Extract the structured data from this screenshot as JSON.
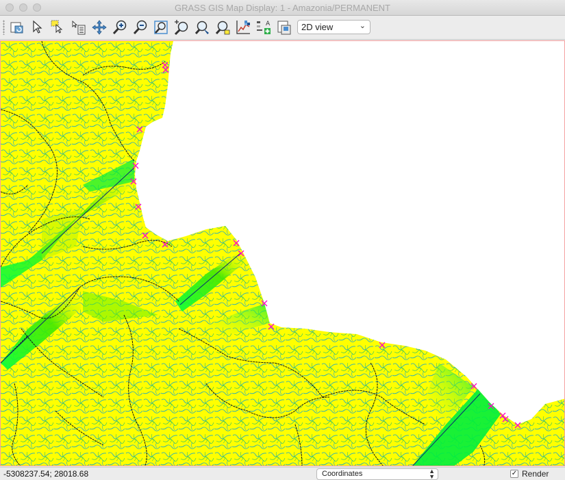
{
  "window": {
    "title": "GRASS GIS Map Display: 1 - Amazonia/PERMANENT"
  },
  "toolbar": {
    "tools": [
      {
        "name": "display-map-icon"
      },
      {
        "name": "pointer-icon"
      },
      {
        "name": "query-icon"
      },
      {
        "name": "pan-icon"
      },
      {
        "name": "zoom-in-icon"
      },
      {
        "name": "zoom-out-icon"
      },
      {
        "name": "zoom-extent-icon"
      },
      {
        "name": "zoom-back-icon"
      },
      {
        "name": "zoom-options-icon"
      },
      {
        "name": "zoom-region-icon"
      },
      {
        "name": "analyze-icon"
      },
      {
        "name": "decorations-icon"
      },
      {
        "name": "save-image-icon"
      }
    ],
    "view_mode": {
      "selected": "2D view"
    }
  },
  "status": {
    "coordinates": "-5308237.54; 28018.68",
    "display_mode": "Coordinates",
    "render_label": "Render",
    "render_checked": true
  },
  "map": {
    "colors": {
      "land": "#ffff00",
      "flow": "#00ff3c",
      "streams": "#1aa8c8",
      "boundaries": "#111111",
      "outlets": "#ff00cc",
      "ocean": "#ffffff"
    },
    "outlet_count": 18
  }
}
